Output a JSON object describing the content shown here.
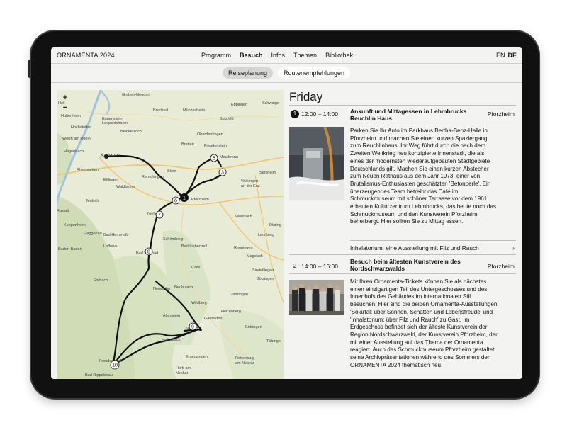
{
  "header": {
    "brand": "ORNAMENTA 2024",
    "nav": [
      "Programm",
      "Besuch",
      "Infos",
      "Themen",
      "Bibliothek"
    ],
    "active_nav": "Besuch",
    "lang": [
      "EN",
      "DE"
    ],
    "active_lang": "DE"
  },
  "subnav": {
    "tabs": [
      "Reiseplanung",
      "Routenempfehlungen"
    ],
    "active": "Reiseplanung"
  },
  "map": {
    "zoom_in": "+",
    "zoom_out": "−",
    "places": [
      "Graben-Neudorf",
      "Eppingen",
      "Schwaige",
      "Bruchsal",
      "Münzesheim",
      "Sulzfeld",
      "Heil",
      "Huttenheim",
      "Eggenstein-Leopoldshafen",
      "Blankenloch",
      "Oberderdingen",
      "Hochstetten",
      "Wörth am Rhein",
      "Bretten",
      "Freudenstein",
      "Hagenbach",
      "Karlsruhe",
      "Maulbronn",
      "Rheinstetten",
      "Remchingen",
      "Stein",
      "Sersheim",
      "Ettlingen",
      "Waldbronn",
      "Vaihingen an der Enz",
      "Malsch",
      "Pforzheim",
      "Niefern",
      "Rastatt",
      "Weissach",
      "Kuppenheim",
      "Ditzing",
      "Gaggenau",
      "Bad Herrenalb",
      "Schömberg",
      "Leonberg",
      "Baden-Baden",
      "Loffenau",
      "Bad Liebenzell",
      "Renningen",
      "Bad Wildbad",
      "Magstadt",
      "Calw",
      "Sindelfingen",
      "Forbach",
      "Neubulach",
      "Böblingen",
      "Neuweiler",
      "Wildberg",
      "Gärtringen",
      "Altensteig",
      "Herrenberg",
      "Nagold",
      "Gäufelden",
      "Entringen",
      "Haiterbach",
      "Tübinge",
      "Freudenstadt",
      "Ergenzingen",
      "Rottenburg am Neckar",
      "Horb am Neckar",
      "Bad Rippoldsau"
    ],
    "markers": [
      "1",
      "3",
      "5",
      "6",
      "7",
      "8",
      "9",
      "10"
    ]
  },
  "itinerary": {
    "day": "Friday",
    "events": [
      {
        "num": "1",
        "time": "12:00 – 14:00",
        "title": "Ankunft und Mittagessen in Lehmbrucks Reuchlin Haus",
        "place": "Pforzheim",
        "lines": [
          "Parken Sie Ihr Auto im Parkhaus Bertha-Benz-Halle in",
          "Pforzheim und machen Sie einen kurzen Spaziergang",
          "zum Reuchlinhaus. Ihr Weg führt durch die nach dem",
          "Zweiten Weltkrieg neu konzipierte Innenstadt, die als",
          "eines der modernsten wiederaufgebauten Stadtgebiete",
          "Deutschlands gilt. Machen Sie einen kurzen Abstecher",
          "zum Neuen Rathaus aus dem Jahr 1973, einer von",
          "Brutalismus-Enthusiasten geschätzten 'Betonperle'. Ein",
          "überzeugendes Team betreibt das Café im",
          "Schmuckmuseum mit schöner Terrasse vor dem 1961",
          "erbauten Kulturzentrum Lehmbrucks, das heute noch das",
          "Schmuckmuseum und den Kunstverein Pforzheim",
          "beherbergt. Hier sollten Sie zu Mittag essen."
        ],
        "link": "Inhalatorium: eine Ausstellung mit Filz und Rauch",
        "link_arrow": "›"
      },
      {
        "num": "2",
        "time": "14:00 – 16:00",
        "title": "Besuch beim ältesten Kunstverein des Nordschwarzwalds",
        "place": "Pforzheim",
        "lines": [
          "Mit Ihren Ornamenta-Tickets können Sie als nächstes",
          "einen einzigartigen Teil des Untergeschosses und des",
          "Innenhofs des Gebäudes im internationalen Stil",
          "besuchen. Hier sind die beiden Ornamenta-Ausstellungen",
          "'Solartal: über Sonnen, Schatten und Lebensfreude' und",
          "'Inhalatorium: über Filz und Rauch' zu Gast. Im",
          "Erdgeschoss befindet sich der älteste Kunstverein der",
          "Region Nordschwarzwald, der Kunstverein Pforzheim, der",
          "mit einer Ausstellung auf das Thema der Ornamenta",
          "reagiert. Auch das Schmuckmuseum Pforzheim gestaltet",
          "seine Archivpräsentationen während des Sommers der",
          "ORNAMENTA 2024 thematisch neu."
        ]
      }
    ]
  }
}
